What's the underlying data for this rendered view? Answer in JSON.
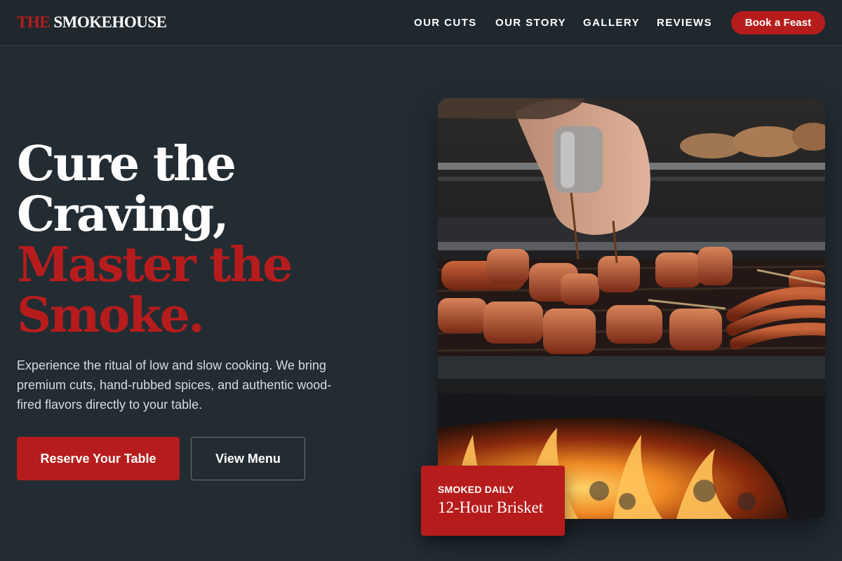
{
  "brand": {
    "accent": "THE",
    "name": "SMOKEHOUSE"
  },
  "nav": {
    "items": [
      {
        "label": "OUR CUTS"
      },
      {
        "label": "OUR STORY"
      },
      {
        "label": "GALLERY"
      },
      {
        "label": "REVIEWS"
      }
    ],
    "cta_label": "Book a Feast"
  },
  "hero": {
    "headline_white_1": "Cure the",
    "headline_white_2": "Craving,",
    "headline_red_1": "Master the",
    "headline_red_2": "Smoke.",
    "description": "Experience the ritual of low and slow cooking. We bring premium cuts, hand-rubbed spices, and authentic wood-fired flavors directly to your table.",
    "primary_button": "Reserve Your Table",
    "secondary_button": "View Menu",
    "image_alt": "Hand brushing sauce onto meat skewers and sausages on a wood-fired grill"
  },
  "badge": {
    "kicker": "SMOKED DAILY",
    "title": "12-Hour Brisket"
  },
  "colors": {
    "background": "#232c33",
    "header": "#20282e",
    "accent_red": "#b71c1c",
    "text_muted": "#d6dadd"
  }
}
